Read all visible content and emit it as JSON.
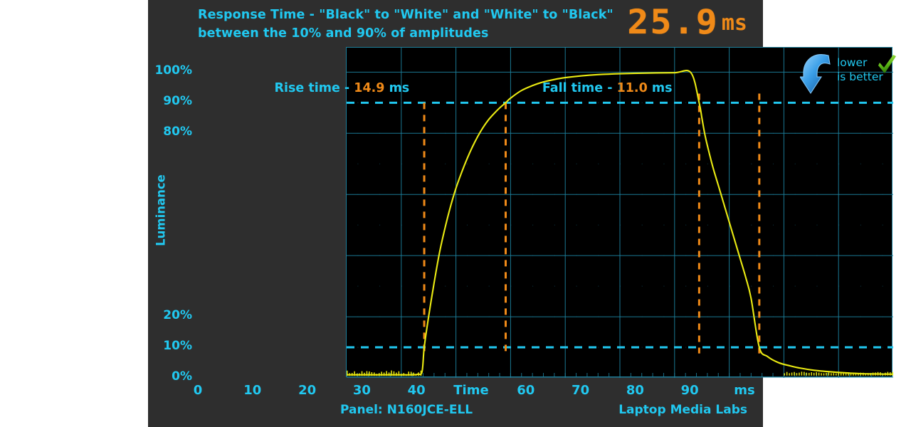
{
  "header": {
    "title_line1": "Response Time - \"Black\" to \"White\" and \"White\" to \"Black\"",
    "title_line2": "between the 10% and 90% of amplitudes",
    "readout_value": "25.9",
    "readout_unit": "ms"
  },
  "badge": {
    "line1": "lower",
    "line2": "is better",
    "arrow_icon": "down-arrow-icon",
    "check_icon": "green-check-icon"
  },
  "annotations": {
    "rise_prefix": "Rise time - ",
    "rise_value": "14.9",
    "rise_unit": "  ms",
    "fall_prefix": "Fall time - ",
    "fall_value": "11.0",
    "fall_unit": "  ms"
  },
  "footer": {
    "panel_label": "Panel: N160JCE-ELL",
    "credit": "Laptop Media Labs"
  },
  "colors": {
    "accent_cyan": "#21c8f0",
    "value_orange": "#f08a18",
    "trace_yellow": "#eaea12",
    "grid_cyan": "#1d7f9b",
    "panel_bg": "#2e2e2e",
    "plot_bg": "#000000"
  },
  "chart_data": {
    "type": "line",
    "title": "Response Time - \"Black\" to \"White\" and \"White\" to \"Black\" between the 10% and 90% of amplitudes",
    "xlabel": "Time",
    "ylabel": "Luminance",
    "x_unit": "ms",
    "y_unit": "%",
    "xlim": [
      0,
      100
    ],
    "ylim": [
      0,
      108
    ],
    "grid": true,
    "legend_position": "none",
    "xticks": [
      0,
      10,
      20,
      30,
      40,
      50,
      60,
      70,
      80,
      90,
      100
    ],
    "xticklabels": [
      "0",
      "10",
      "20",
      "30",
      "40",
      "Time",
      "60",
      "70",
      "80",
      "90",
      "ms"
    ],
    "yticks": [
      0,
      10,
      20,
      80,
      90,
      100
    ],
    "yticklabels": [
      "0%",
      "10%",
      "20%",
      "80%",
      "90%",
      "100%"
    ],
    "threshold_lines": [
      {
        "label": "90% amplitude",
        "y": 90,
        "style": "dashed",
        "color": "#21c8f0"
      },
      {
        "label": "10% amplitude",
        "y": 10,
        "style": "dashed",
        "color": "#21c8f0"
      }
    ],
    "markers": [
      {
        "label": "rise start (10%)",
        "x": 14.2,
        "style": "dashed",
        "color": "#f08a18"
      },
      {
        "label": "rise end (90%)",
        "x": 29.1,
        "style": "dashed",
        "color": "#f08a18"
      },
      {
        "label": "fall start (90%)",
        "x": 64.5,
        "style": "dashed",
        "color": "#f08a18"
      },
      {
        "label": "fall end (10%)",
        "x": 75.5,
        "style": "dashed",
        "color": "#f08a18"
      }
    ],
    "measurements": {
      "rise_time_ms": 14.9,
      "fall_time_ms": 11.0,
      "total_response_ms": 25.9
    },
    "series": [
      {
        "name": "Luminance",
        "color": "#eaea12",
        "x": [
          0,
          2,
          4,
          6,
          8,
          10,
          12,
          13,
          13.8,
          14.2,
          15,
          16,
          17,
          18,
          19,
          20,
          21,
          22,
          23,
          24,
          25,
          26,
          27,
          28,
          29.1,
          30,
          32,
          34,
          36,
          38,
          40,
          43,
          46,
          50,
          55,
          60,
          63,
          64.5,
          65,
          65.5,
          66,
          67,
          68,
          69,
          70,
          71,
          72,
          73,
          74,
          75.5,
          77,
          79,
          81,
          83,
          86,
          90,
          94,
          100
        ],
        "y": [
          1,
          1,
          1,
          1,
          1,
          1,
          1,
          1.2,
          2,
          10,
          20,
          31,
          41,
          49,
          56,
          62,
          67,
          71.5,
          75.5,
          79,
          82,
          84.5,
          86.5,
          88.3,
          90,
          91.5,
          94,
          95.6,
          96.8,
          97.6,
          98.2,
          98.8,
          99.2,
          99.5,
          99.7,
          99.8,
          99.8,
          90,
          85,
          80,
          76,
          69,
          63,
          57,
          51,
          45,
          39,
          33,
          26,
          10,
          7,
          5,
          4,
          3.2,
          2.4,
          1.8,
          1.4,
          1.2
        ]
      }
    ]
  }
}
